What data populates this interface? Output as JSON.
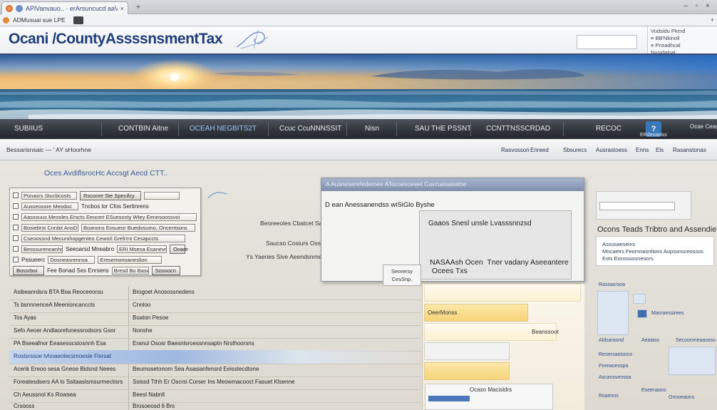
{
  "browser": {
    "tab_title": "APlVanvauo.. · erArsuncucd aaVB",
    "tab_close": "×",
    "new_tab": "+",
    "window_controls": "– ▫ ×",
    "address": "ADMusuai sue LPE",
    "address_right": "+"
  },
  "header": {
    "site_title": "Ocani /CountyAssssnsmentTax",
    "side_panel": [
      "Vudsidu Pkrnd",
      "≡ BB'Nkinoll",
      "≡ Pnsadhcal",
      "Nusidalsal"
    ]
  },
  "nav": {
    "items": [
      "SUBIIUS",
      "CONTBIN Aitne",
      "OCEAH NEGBITS2T",
      "Ccuc CcuNNNSSIT",
      "Nisn",
      "SAU THE PSSNT",
      "CCNTTNSSCRDAD",
      "RECOC"
    ],
    "help": "?",
    "right_items": [
      "ERdenaeiss",
      "Ocae Ceas"
    ]
  },
  "subbar": {
    "breadcrumb": "Bessarisnsaic — ' AY sHoorhne",
    "links": [
      "Rasvosson",
      "Enreed",
      "Sbsurecs",
      "Ausrastoess",
      "Enns",
      "Els",
      "Rasanstonas"
    ]
  },
  "main": {
    "section_title": "Oces AvdiflsrocHc Accsgt Aecd CTT..",
    "form": {
      "row1": [
        "Ponasrs Stucbcosts",
        "Rsconre Ste Specifcy"
      ],
      "row2": [
        "Ausseossre Meodoc",
        "Tncbos lor Cfos Sertinrens"
      ],
      "row3": [
        "Aasxouus Meosles Erscts Eeoceri ESuesosty Wtey Eenesoossvoi"
      ],
      "row4": [
        "Bosiebrst Cnnbit AnoD",
        "Boanons Eosueor Buedosumo, Oncentsons"
      ],
      "row5": [
        "Cseoossnd Mecurshopgenteo Cewsrl Grelrrnt Cesapccts"
      ],
      "row6": [
        "Besssurenoanhs",
        "Seeoarsd Mneabro",
        "ERI Msesa Esanevrot Eefoloe",
        "Ooare"
      ],
      "row7": [
        "Pssueerc",
        "Dosneasrennsa",
        "Eresemonoaneslion"
      ],
      "row8": [
        "Bossrboi",
        "Fee Bonad Ses Enrsens",
        "Bresd Bo Baswosd",
        "Sosoocn"
      ]
    },
    "middle": {
      "subheading": "Beoreeoles Cbatcet Saet",
      "line1": "Saucso Cosiurs Ossssicoss Iumuxneaseto",
      "line2": "Ys  Yaeries Sive Aeendsnment Leasitoite Adc Woodensunt"
    },
    "dialog": {
      "bar_text": "A Ausneserefedemee ATocoesoeeet Cuvcuesaeatne",
      "heading": "D ean Anessanendss wiSiGlo Byshe",
      "panel_line1": "Gaaos Snesl unsle Lvasssnnzsd",
      "panel_line2": "NASAAsh Ocen  Tner vadany Aseeantere\n Ocees Txs"
    },
    "preview_button": "Seorersy\nCesSnp.",
    "right": {
      "heading": "Ocons Teads Tribtro and Assendie",
      "info": [
        "Assusaeseins",
        "Mncaetrs Feomnasntions Aopssnsceossss",
        "Ests Eonsssosnesors"
      ]
    },
    "table_rows": [
      [
        "Asibeanrdsra BTA Boa Reoceeorsu",
        "Brogoet Anosossnedens"
      ],
      [
        "Ts bsnnnenceA      Meenioncanccts",
        "Cnnloo"
      ],
      [
        "Tos Ayas",
        "Boaton Pesoe"
      ],
      [
        "Sefo Aeoer Andlaorefunessrodsors Gsor",
        "Nonshe"
      ],
      [
        "PA Bseeafnor Eeasesocstosnnh Esa",
        "Eranul Ososr Baesnlsroessnnsaptn Nrsthoorsns"
      ],
      [
        "Rostsrssoe lvhoaeotecsmoesie Fisrsat",
        ""
      ],
      [
        "Acerik Ereoo sesa Gneoe   Bidsnd Neees",
        "Beumosetonom    Sea Asasianfensrd Eeisstecdtone"
      ],
      [
        "Foreatesdsers   AA lo Ssitaaslsmsurmectisrs",
        "Ssissd Tthh   Er Oscrsi Corser Ins Meowmacooct Fasuet Klsenne"
      ],
      [
        "Ch Aeussnol Ks    Rowsea",
        "Beesl Nabnll"
      ],
      [
        "Crsooss",
        "Brosoeosd 6 Brs"
      ]
    ],
    "yellow": {
      "row1": "OeerMonss",
      "row2": "Beanssoot",
      "lower_text": "Ocaso Macisldrs"
    },
    "right_side": [
      "Rassasrsoa",
      "Macraessirees",
      "Aldsarasnd",
      "Aeaiass",
      "Secoonmeaasoso",
      "Reoersaotsons",
      "Poreaoesspa",
      "Ascansvensoa",
      "Eseenaonc",
      "Rsaenns",
      "Onnoeaons"
    ]
  },
  "colors": {
    "nav_bg": "#2f333a",
    "title_blue": "#1f3d7a",
    "accent_blue": "#3a77b8",
    "highlight_yellow": "#f6d47a"
  }
}
